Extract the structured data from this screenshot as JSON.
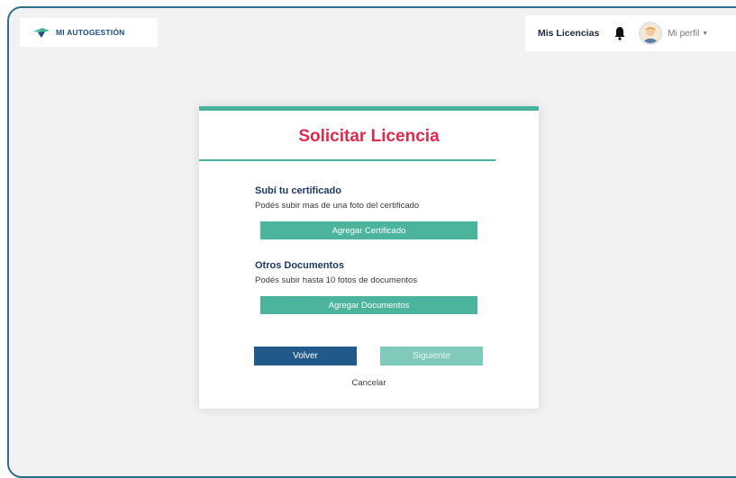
{
  "header": {
    "brand": "MI AUTOGESTIÓN",
    "nav_link": "Mis Licencias",
    "profile_label": "Mi perfil"
  },
  "card": {
    "title": "Solicitar Licencia",
    "certificate": {
      "title": "Subí tu certificado",
      "description": "Podés subir mas de una foto del certificado",
      "button": "Agregar Certificado"
    },
    "documents": {
      "title": "Otros Documentos",
      "description": "Podés subir hasta 10 fotos de documentos",
      "button": "Agregar Documentos"
    },
    "back_button": "Volver",
    "next_button": "Siguiente",
    "cancel_link": "Cancelar"
  },
  "colors": {
    "accent_green": "#4cb39c",
    "title_red": "#e0294f",
    "primary_blue": "#215a8a"
  },
  "icons": [
    "brand-logo-icon",
    "bell-icon",
    "avatar",
    "caret-down-icon"
  ]
}
